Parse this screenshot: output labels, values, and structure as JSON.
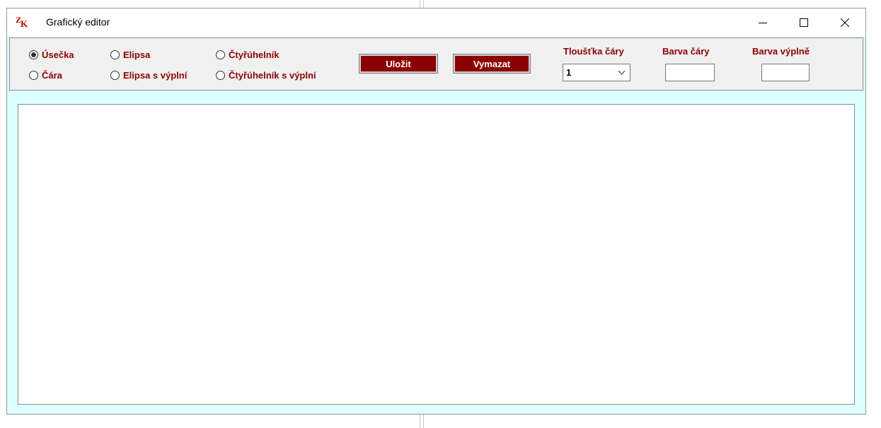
{
  "window": {
    "title": "Grafický editor",
    "icon_letters": {
      "z": "Z",
      "k": "K"
    }
  },
  "title_controls": {
    "minimize": "minimize-icon",
    "maximize": "maximize-icon",
    "close": "close-icon"
  },
  "shapes": [
    {
      "label": "Úsečka",
      "selected": true
    },
    {
      "label": "Čára",
      "selected": false
    },
    {
      "label": "Elipsa",
      "selected": false
    },
    {
      "label": "Elipsa s výplní",
      "selected": false
    },
    {
      "label": "Čtyřúhelník",
      "selected": false
    },
    {
      "label": "Čtyřúhelník s výplní",
      "selected": false
    }
  ],
  "buttons": {
    "save": "Uložit",
    "clear": "Vymazat"
  },
  "line_width": {
    "label": "Tloušťka čáry",
    "value": "1"
  },
  "line_color": {
    "label": "Barva čáry",
    "value": "#ffffff"
  },
  "fill_color": {
    "label": "Barva výplně",
    "value": "#ffffff"
  },
  "colors": {
    "accent": "#8b0000",
    "window_bg": "#dcffff",
    "toolbar_bg": "#f0f0f0"
  }
}
